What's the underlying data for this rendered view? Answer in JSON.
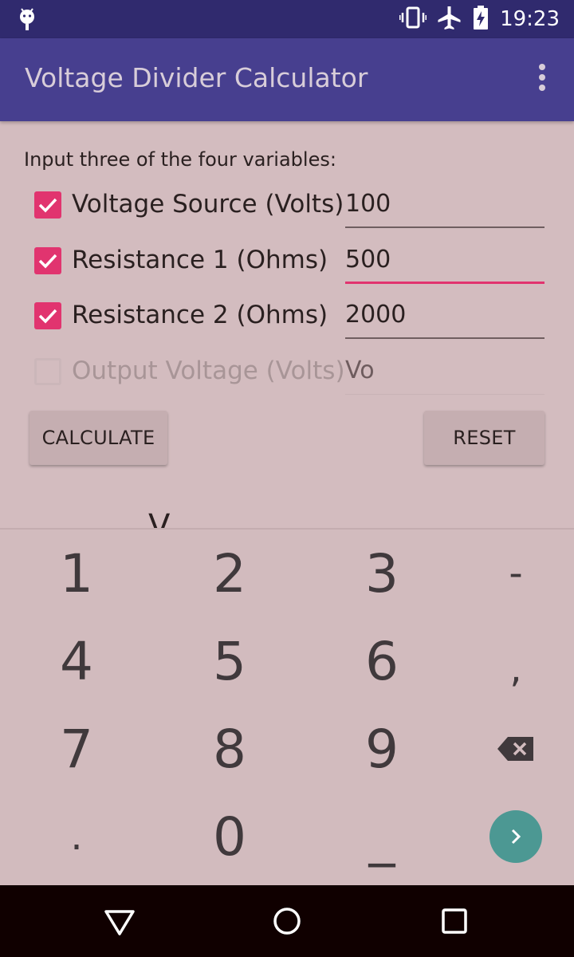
{
  "status_bar": {
    "time": "19:23"
  },
  "app_bar": {
    "title": "Voltage Divider Calculator"
  },
  "form": {
    "instruction": "Input three of the four variables:",
    "rows": [
      {
        "label": "Voltage Source (Volts)",
        "value": "100",
        "checked": true,
        "enabled": true
      },
      {
        "label": "Resistance 1 (Ohms)",
        "value": "500",
        "checked": true,
        "enabled": true,
        "focused": true
      },
      {
        "label": "Resistance 2 (Ohms)",
        "value": "2000",
        "checked": true,
        "enabled": true
      },
      {
        "label": "Output Voltage (Volts)",
        "value": "Vo",
        "checked": false,
        "enabled": false
      }
    ],
    "calculate_label": "CALCULATE",
    "reset_label": "RESET"
  },
  "keyboard": {
    "keys": [
      "1",
      "2",
      "3",
      "-",
      "4",
      "5",
      "6",
      ",",
      "7",
      "8",
      "9",
      ".",
      "0",
      "_"
    ],
    "delete_icon": "backspace-icon",
    "enter_icon": "chevron-right-icon"
  },
  "colors": {
    "accent": "#e1346f",
    "app_bar": "#473f8f",
    "status_bar": "#302a6e",
    "enter_key": "#4c9893"
  }
}
